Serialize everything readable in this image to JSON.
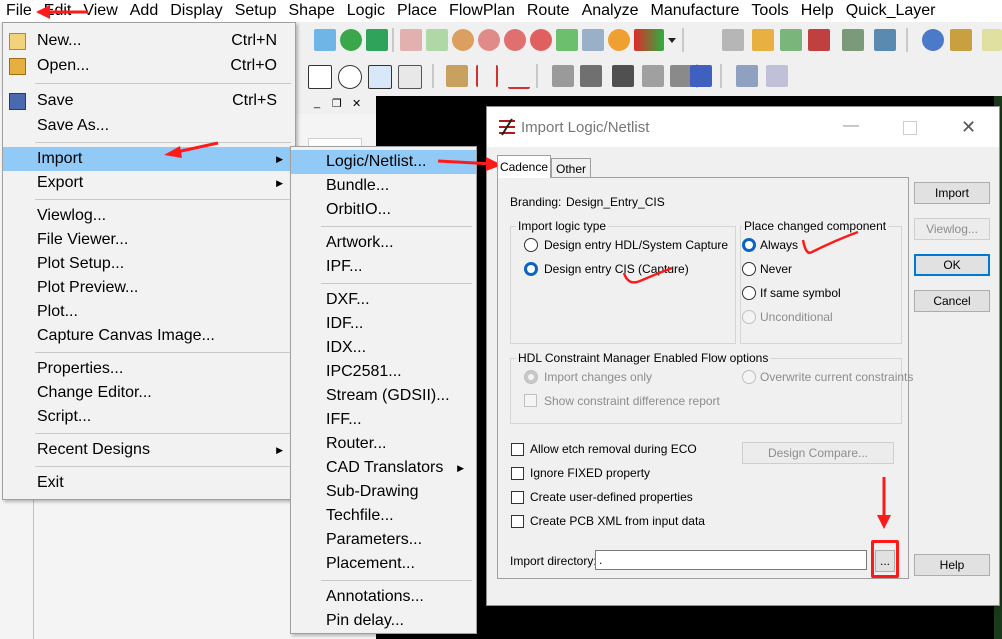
{
  "menubar": {
    "items": [
      "File",
      "Edit",
      "View",
      "Add",
      "Display",
      "Setup",
      "Shape",
      "Logic",
      "Place",
      "FlowPlan",
      "Route",
      "Analyze",
      "Manufacture",
      "Tools",
      "Help",
      "Quick_Layer"
    ]
  },
  "file_menu": {
    "new": "New...",
    "new_shortcut": "Ctrl+N",
    "open": "Open...",
    "open_shortcut": "Ctrl+O",
    "save": "Save",
    "save_shortcut": "Ctrl+S",
    "save_as": "Save As...",
    "import": "Import",
    "export": "Export",
    "viewlog": "Viewlog...",
    "file_viewer": "File Viewer...",
    "plot_setup": "Plot Setup...",
    "plot_preview": "Plot Preview...",
    "plot": "Plot...",
    "capture_canvas": "Capture Canvas Image...",
    "properties": "Properties...",
    "change_editor": "Change Editor...",
    "script": "Script...",
    "recent_designs": "Recent Designs",
    "exit": "Exit"
  },
  "import_menu": {
    "items": [
      "Logic/Netlist...",
      "Bundle...",
      "OrbitIO...",
      "Artwork...",
      "IPF...",
      "DXF...",
      "IDF...",
      "IDX...",
      "IPC2581...",
      "Stream (GDSII)...",
      "IFF...",
      "Router...",
      "CAD Translators",
      "Sub-Drawing",
      "Techfile...",
      "Parameters...",
      "Placement...",
      "Annotations...",
      "Pin delay..."
    ]
  },
  "dialog": {
    "title": "Import Logic/Netlist",
    "tabs": [
      "Cadence",
      "Other"
    ],
    "branding_label": "Branding:",
    "branding_value": "Design_Entry_CIS",
    "logic_type_group": "Import logic type",
    "logic_type_hdl": "Design entry HDL/System Capture",
    "logic_type_cis": "Design entry CIS (Capture)",
    "place_group": "Place changed component",
    "place_always": "Always",
    "place_never": "Never",
    "place_same": "If same symbol",
    "place_unconditional": "Unconditional",
    "hdl_group": "HDL Constraint Manager Enabled Flow options",
    "hdl_import_only": "Import changes only",
    "hdl_overwrite": "Overwrite current constraints",
    "hdl_show_diff": "Show constraint difference report",
    "allow_etch": "Allow etch removal during ECO",
    "ignore_fixed": "Ignore FIXED property",
    "create_udp": "Create user-defined properties",
    "create_xml": "Create PCB XML from input data",
    "design_compare": "Design Compare...",
    "import_dir_label": "Import directory:",
    "import_dir_value": ".",
    "browse": "...",
    "btn_import": "Import",
    "btn_viewlog": "Viewlog...",
    "btn_ok": "OK",
    "btn_cancel": "Cancel",
    "btn_help": "Help"
  },
  "colors": {
    "annotation": "#ff1a1a",
    "highlight": "#91c9f7",
    "radio_selected": "#0a64c8"
  }
}
